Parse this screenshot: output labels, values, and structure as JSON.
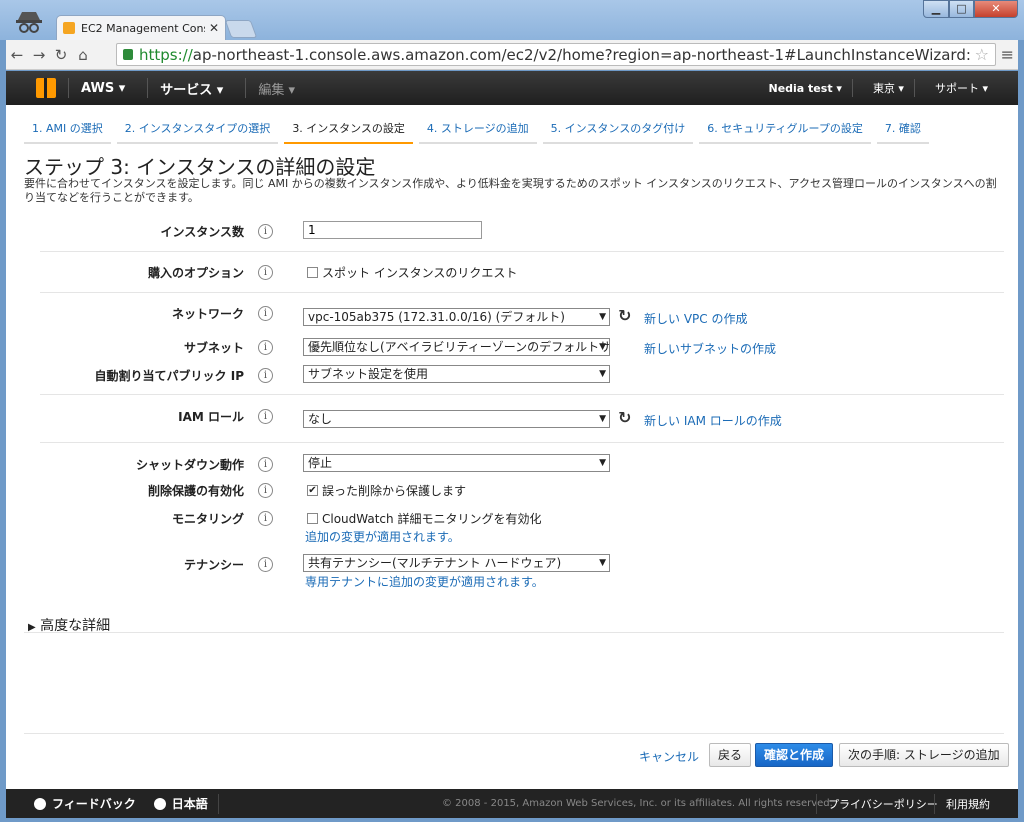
{
  "browser": {
    "tab_title": "EC2 Management Cons",
    "url_scheme": "https://",
    "url_rest": "ap-northeast-1.console.aws.amazon.com/ec2/v2/home?region=ap-northeast-1#LaunchInstanceWizard:"
  },
  "header": {
    "aws_label": "AWS",
    "services_label": "サービス",
    "edit_label": "編集",
    "user_label": "Nedia test",
    "region_label": "東京",
    "support_label": "サポート"
  },
  "steps": [
    {
      "label": "1. AMI の選択"
    },
    {
      "label": "2. インスタンスタイプの選択"
    },
    {
      "label": "3. インスタンスの設定"
    },
    {
      "label": "4. ストレージの追加"
    },
    {
      "label": "5. インスタンスのタグ付け"
    },
    {
      "label": "6. セキュリティグループの設定"
    },
    {
      "label": "7. 確認"
    }
  ],
  "main": {
    "title": "ステップ 3: インスタンスの詳細の設定",
    "description": "要件に合わせてインスタンスを設定します。同じ AMI からの複数インスタンス作成や、より低料金を実現するためのスポット インスタンスのリクエスト、アクセス管理ロールのインスタンスへの割り当てなどを行うことができます。"
  },
  "form": {
    "instance_count_label": "インスタンス数",
    "instance_count_value": "1",
    "purchase_label": "購入のオプション",
    "spot_request_label": "スポット インスタンスのリクエスト",
    "network_label": "ネットワーク",
    "network_value": "vpc-105ab375 (172.31.0.0/16) (デフォルト)",
    "new_vpc_link": "新しい VPC の作成",
    "subnet_label": "サブネット",
    "subnet_value": "優先順位なし(アベイラビリティーゾーンのデフォルトサブ",
    "new_subnet_link": "新しいサブネットの作成",
    "auto_ip_label": "自動割り当てパブリック IP",
    "auto_ip_value": "サブネット設定を使用",
    "iam_label": "IAM ロール",
    "iam_value": "なし",
    "new_iam_link": "新しい IAM ロールの作成",
    "shutdown_label": "シャットダウン動作",
    "shutdown_value": "停止",
    "termination_label": "削除保護の有効化",
    "termination_check_label": "誤った削除から保護します",
    "monitoring_label": "モニタリング",
    "monitoring_check_label": "CloudWatch 詳細モニタリングを有効化",
    "monitoring_note": "追加の変更が適用されます。",
    "tenancy_label": "テナンシー",
    "tenancy_value": "共有テナンシー(マルチテナント ハードウェア)",
    "tenancy_note": "専用テナントに追加の変更が適用されます。",
    "advanced_label": "高度な詳細"
  },
  "actions": {
    "cancel": "キャンセル",
    "back": "戻る",
    "review_launch": "確認と作成",
    "next": "次の手順: ストレージの追加"
  },
  "footer": {
    "feedback": "フィードバック",
    "language": "日本語",
    "copyright": "© 2008 - 2015, Amazon Web Services, Inc. or its affiliates. All rights reserved.",
    "privacy": "プライバシーポリシー",
    "terms": "利用規約"
  }
}
